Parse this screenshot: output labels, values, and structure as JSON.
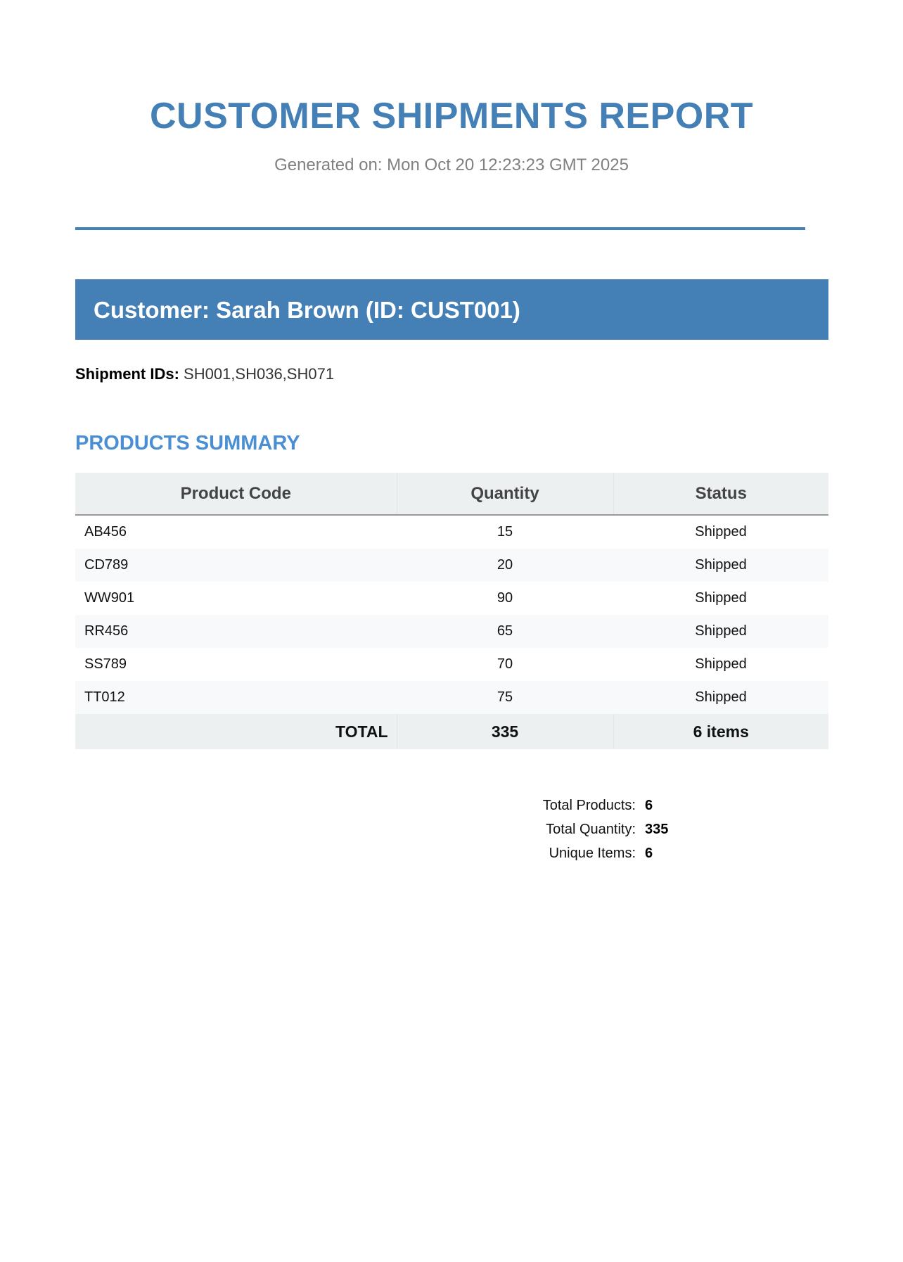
{
  "report": {
    "title": "CUSTOMER SHIPMENTS REPORT",
    "generated": "Generated on: Mon Oct 20 12:23:23 GMT 2025"
  },
  "customer": {
    "heading": "Customer: Sarah Brown (ID: CUST001)",
    "shipment_ids_label": "Shipment IDs:",
    "shipment_ids": "SH001,SH036,SH071"
  },
  "products_summary": {
    "title": "PRODUCTS SUMMARY",
    "columns": [
      "Product Code",
      "Quantity",
      "Status"
    ],
    "rows": [
      {
        "code": "AB456",
        "quantity": "15",
        "status": "Shipped"
      },
      {
        "code": "CD789",
        "quantity": "20",
        "status": "Shipped"
      },
      {
        "code": "WW901",
        "quantity": "90",
        "status": "Shipped"
      },
      {
        "code": "RR456",
        "quantity": "65",
        "status": "Shipped"
      },
      {
        "code": "SS789",
        "quantity": "70",
        "status": "Shipped"
      },
      {
        "code": "TT012",
        "quantity": "75",
        "status": "Shipped"
      }
    ],
    "total": {
      "label": "TOTAL",
      "quantity": "335",
      "items": "6 items"
    }
  },
  "stats": [
    {
      "label": "Total Products:",
      "value": "6"
    },
    {
      "label": "Total Quantity:",
      "value": "335"
    },
    {
      "label": "Unique Items:",
      "value": "6"
    }
  ],
  "colors": {
    "accent": "#4480b6",
    "section_title": "#4a8fd4",
    "header_bg": "#ecf0f1",
    "muted_text": "#808080"
  }
}
